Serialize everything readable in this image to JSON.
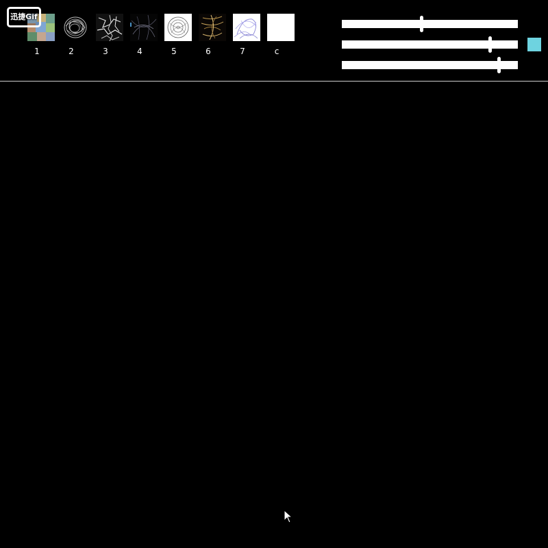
{
  "badge": {
    "text": "迅捷Gif"
  },
  "thumbnails": [
    {
      "label": "1"
    },
    {
      "label": "2"
    },
    {
      "label": "3"
    },
    {
      "label": "4"
    },
    {
      "label": "5"
    },
    {
      "label": "6"
    },
    {
      "label": "7"
    },
    {
      "label": "c"
    }
  ],
  "sliders": [
    {
      "value_fraction": 0.45
    },
    {
      "value_fraction": 0.84
    },
    {
      "value_fraction": 0.89
    }
  ],
  "colors": {
    "background": "#000000",
    "swatch": "#6ed3e0",
    "separator": "#cfcfcf"
  },
  "icons": {
    "cursor": "mouse-pointer-icon"
  }
}
